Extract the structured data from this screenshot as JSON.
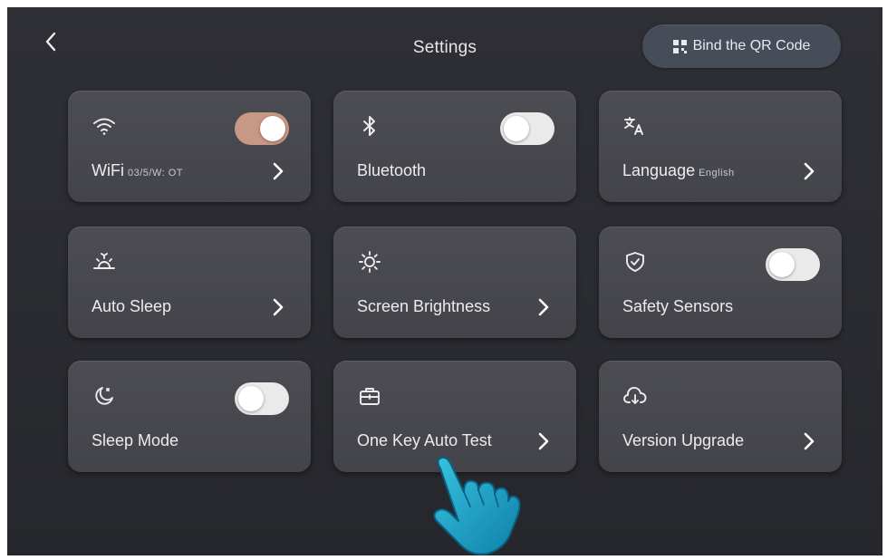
{
  "header": {
    "title": "Settings",
    "qr_button_label": "Bind the QR Code"
  },
  "tiles": [
    {
      "label": "WiFi",
      "sub": "03/5/W: OT",
      "icon": "wifi-icon",
      "toggle": "on"
    },
    {
      "label": "Bluetooth",
      "icon": "bluetooth-icon",
      "toggle": "off"
    },
    {
      "label": "Language",
      "sub": "English",
      "icon": "translate-icon"
    },
    {
      "label": "Auto Sleep",
      "icon": "sun-set-icon"
    },
    {
      "label": "Screen Brightness",
      "icon": "brightness-icon"
    },
    {
      "label": "Safety Sensors",
      "icon": "shield-check-icon",
      "toggle": "off"
    },
    {
      "label": "Sleep Mode",
      "icon": "moon-icon",
      "toggle": "off"
    },
    {
      "label": "One Key Auto Test",
      "icon": "toolbox-icon"
    },
    {
      "label": "Version Upgrade",
      "icon": "cloud-download-icon"
    }
  ],
  "colors": {
    "background": "#2b2c31",
    "tile": "#47484e",
    "toggle_on": "#c79884",
    "toggle_off": "#eaeaea",
    "qr_button": "#474c59",
    "pointer_hand": "#1ea9c9"
  },
  "overlay": {
    "icon": "pointing-hand-icon"
  }
}
